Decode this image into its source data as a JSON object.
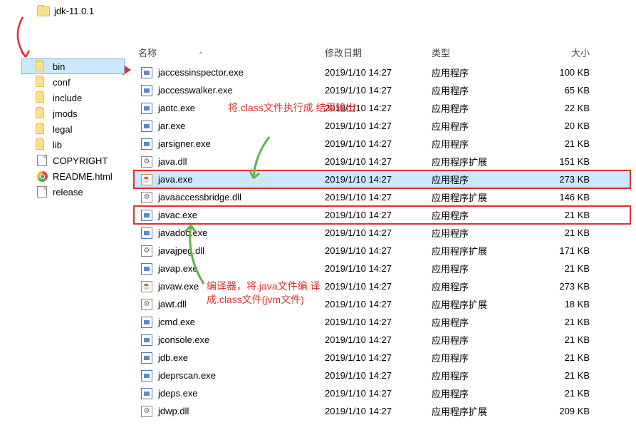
{
  "root_folder": "jdk-11.0.1",
  "sidebar": {
    "items": [
      {
        "name": "bin",
        "type": "folder",
        "selected": true
      },
      {
        "name": "conf",
        "type": "folder"
      },
      {
        "name": "include",
        "type": "folder"
      },
      {
        "name": "jmods",
        "type": "folder"
      },
      {
        "name": "legal",
        "type": "folder"
      },
      {
        "name": "lib",
        "type": "folder"
      },
      {
        "name": "COPYRIGHT",
        "type": "file"
      },
      {
        "name": "README.html",
        "type": "chrome"
      },
      {
        "name": "release",
        "type": "file"
      }
    ]
  },
  "columns": {
    "name": "名称",
    "date": "修改日期",
    "type": "类型",
    "size": "大小"
  },
  "files": [
    {
      "name": "jaccessinspector.exe",
      "date": "2019/1/10 14:27",
      "type": "应用程序",
      "size": "100 KB",
      "icon": "exe"
    },
    {
      "name": "jaccesswalker.exe",
      "date": "2019/1/10 14:27",
      "type": "应用程序",
      "size": "65 KB",
      "icon": "exe"
    },
    {
      "name": "jaotc.exe",
      "date": "2019/1/10 14:27",
      "type": "应用程序",
      "size": "22 KB",
      "icon": "exe"
    },
    {
      "name": "jar.exe",
      "date": "2019/1/10 14:27",
      "type": "应用程序",
      "size": "20 KB",
      "icon": "exe"
    },
    {
      "name": "jarsigner.exe",
      "date": "2019/1/10 14:27",
      "type": "应用程序",
      "size": "21 KB",
      "icon": "exe"
    },
    {
      "name": "java.dll",
      "date": "2019/1/10 14:27",
      "type": "应用程序扩展",
      "size": "151 KB",
      "icon": "dll"
    },
    {
      "name": "java.exe",
      "date": "2019/1/10 14:27",
      "type": "应用程序",
      "size": "273 KB",
      "icon": "app",
      "selected": true,
      "boxed": true
    },
    {
      "name": "javaaccessbridge.dll",
      "date": "2019/1/10 14:27",
      "type": "应用程序扩展",
      "size": "146 KB",
      "icon": "dll"
    },
    {
      "name": "javac.exe",
      "date": "2019/1/10 14:27",
      "type": "应用程序",
      "size": "21 KB",
      "icon": "exe",
      "boxed": true
    },
    {
      "name": "javadoc.exe",
      "date": "2019/1/10 14:27",
      "type": "应用程序",
      "size": "21 KB",
      "icon": "exe"
    },
    {
      "name": "javajpeg.dll",
      "date": "2019/1/10 14:27",
      "type": "应用程序扩展",
      "size": "171 KB",
      "icon": "dll"
    },
    {
      "name": "javap.exe",
      "date": "2019/1/10 14:27",
      "type": "应用程序",
      "size": "21 KB",
      "icon": "exe"
    },
    {
      "name": "javaw.exe",
      "date": "2019/1/10 14:27",
      "type": "应用程序",
      "size": "273 KB",
      "icon": "app"
    },
    {
      "name": "jawt.dll",
      "date": "2019/1/10 14:27",
      "type": "应用程序扩展",
      "size": "18 KB",
      "icon": "dll"
    },
    {
      "name": "jcmd.exe",
      "date": "2019/1/10 14:27",
      "type": "应用程序",
      "size": "21 KB",
      "icon": "exe"
    },
    {
      "name": "jconsole.exe",
      "date": "2019/1/10 14:27",
      "type": "应用程序",
      "size": "21 KB",
      "icon": "exe"
    },
    {
      "name": "jdb.exe",
      "date": "2019/1/10 14:27",
      "type": "应用程序",
      "size": "21 KB",
      "icon": "exe"
    },
    {
      "name": "jdeprscan.exe",
      "date": "2019/1/10 14:27",
      "type": "应用程序",
      "size": "21 KB",
      "icon": "exe"
    },
    {
      "name": "jdeps.exe",
      "date": "2019/1/10 14:27",
      "type": "应用程序",
      "size": "21 KB",
      "icon": "exe"
    },
    {
      "name": "jdwp.dll",
      "date": "2019/1/10 14:27",
      "type": "应用程序扩展",
      "size": "209 KB",
      "icon": "dll"
    }
  ],
  "annotations": {
    "a1": "将.class文件执行成\n结果输出",
    "a2": "编译器，将.java文件编\n译成.class文件(jvm文件)"
  }
}
